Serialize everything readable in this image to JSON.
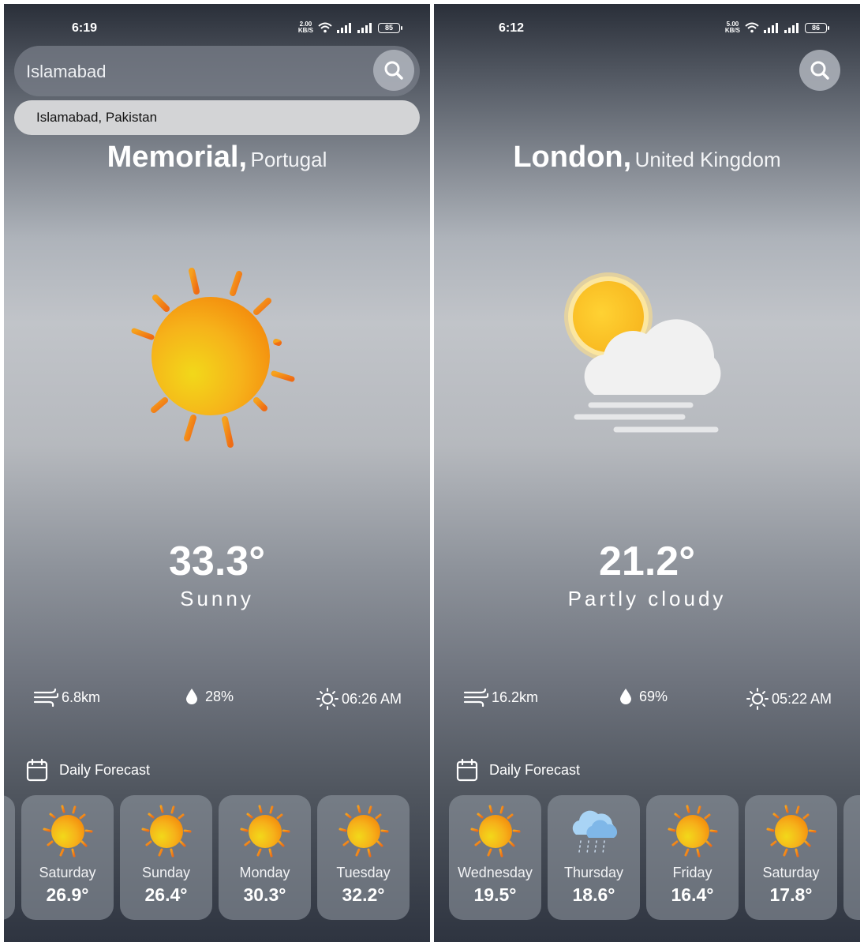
{
  "left": {
    "status": {
      "time": "6:19",
      "net_value": "2.00",
      "net_unit": "KB/S",
      "battery": "85"
    },
    "search": {
      "value": "Islamabad"
    },
    "suggestion": "Islamabad, Pakistan",
    "location": {
      "city": "Memorial,",
      "country": "Portugal"
    },
    "main_icon": "sun-icon",
    "temperature": "33.3°",
    "condition": "Sunny",
    "stats": {
      "wind": "6.8km",
      "humidity": "28%",
      "sunrise": "06:26 AM"
    },
    "forecast_title": "Daily Forecast",
    "forecast": [
      {
        "day": "Saturday",
        "temp": "26.9°",
        "icon": "sun-icon"
      },
      {
        "day": "Sunday",
        "temp": "26.4°",
        "icon": "sun-icon"
      },
      {
        "day": "Monday",
        "temp": "30.3°",
        "icon": "sun-icon"
      },
      {
        "day": "Tuesday",
        "temp": "32.2°",
        "icon": "sun-icon"
      }
    ]
  },
  "right": {
    "status": {
      "time": "6:12",
      "net_value": "5.00",
      "net_unit": "KB/S",
      "battery": "86"
    },
    "location": {
      "city": "London,",
      "country": "United Kingdom"
    },
    "main_icon": "partly-cloudy-icon",
    "temperature": "21.2°",
    "condition": "Partly cloudy",
    "stats": {
      "wind": "16.2km",
      "humidity": "69%",
      "sunrise": "05:22 AM"
    },
    "forecast_title": "Daily Forecast",
    "forecast": [
      {
        "day": "Wednesday",
        "temp": "19.5°",
        "icon": "sun-icon"
      },
      {
        "day": "Thursday",
        "temp": "18.6°",
        "icon": "rain-cloud-icon"
      },
      {
        "day": "Friday",
        "temp": "16.4°",
        "icon": "sun-icon"
      },
      {
        "day": "Saturday",
        "temp": "17.8°",
        "icon": "sun-icon"
      }
    ]
  },
  "colors": {
    "sun_yellow": "#f5c518",
    "sun_orange": "#f57c00",
    "text": "#ffffff"
  }
}
